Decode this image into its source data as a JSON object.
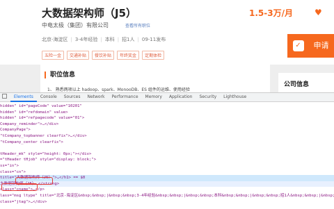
{
  "job": {
    "title": "大数据架构师（J5）",
    "salary": "1.5-3万/月",
    "favorite_label": "收藏",
    "company": "中电太极（集团）有限公司",
    "company_link": "查看所有职位",
    "meta": [
      "北京-海淀区",
      "3-4年经验",
      "本科",
      "招1人",
      "09-11发布"
    ],
    "tags": [
      "五险一金",
      "交通补贴",
      "餐饮补贴",
      "年终奖金",
      "定期体检"
    ],
    "apply_label": "申请",
    "section_title": "职位信息",
    "section_text": "1、 熟悉两项以上 hadoop、spark、MonooDB、ES 组件的运维、使用经验",
    "side_title": "公司信息"
  },
  "devtools": {
    "tabs": [
      "Elements",
      "Console",
      "Sources",
      "Network",
      "Performance",
      "Memory",
      "Application",
      "Security",
      "Lighthouse"
    ],
    "active_tab": "Elements",
    "code_lines": [
      "hidden\" id=\"pageCode\" value=\"10201\"",
      "hidden\" id=\"refdomain\" value>",
      "hidden\" id=\"refpagecode\" value=\"01\">",
      "Company_reminder\">…</div>",
      "CompanyPage\">",
      "\"tCompany_topbanner clearfix\">…</div>",
      "\"tCompany_center clearfix\">",
      "",
      "tHeader_mk\" style=\"height: 0px;\"></div>",
      "=\"tHeader tHjob\" style=\"display: block;\">",
      "ss=\"in\">",
      "class=\"cn\">",
      "title=\"大数据架构师（J5）\">…</h1> == $0",
      "大数据架构师（J5） </strong>",
      "class=\"cname\">…</p>",
      "lass=\"msg ltype\" title=\"北京-海淀区&nbsp;&nbsp;|&nbsp;&nbsp;3-4年经验&nbsp;&nbsp;|&nbsp;&nbsp;本科&nbsp;&nbsp;|&nbsp;&nbsp;招1人&nbsp;&nbsp;|&nbsp;&nbsp;",
      "class=\"jtag\">…</div>"
    ]
  }
}
